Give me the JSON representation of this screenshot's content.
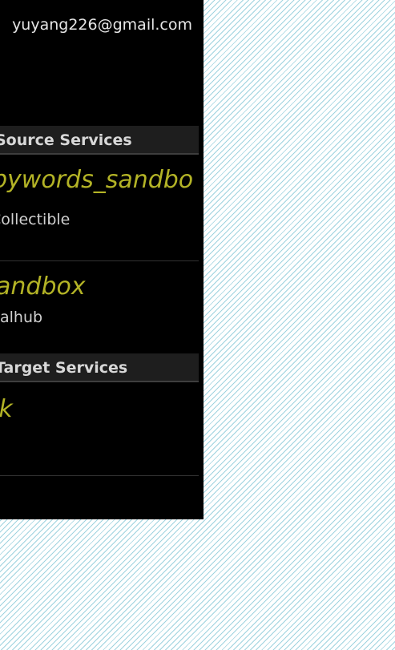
{
  "account": {
    "email": "yuyang226@gmail.com"
  },
  "source_section": {
    "header": "Source Services",
    "items": [
      {
        "title": "pywords_sandbo",
        "subtitle": "Collectible"
      },
      {
        "title": "andbox",
        "subtitle": "alhub"
      }
    ]
  },
  "target_section": {
    "header": "Target Services",
    "items": [
      {
        "title": "ok",
        "subtitle": ""
      }
    ]
  },
  "colors": {
    "panel_background": "#000000",
    "header_background": "#1e1e1e",
    "item_title": "#b3b326",
    "text": "#e6e6e6",
    "outside_pattern": "#9fd3df"
  }
}
